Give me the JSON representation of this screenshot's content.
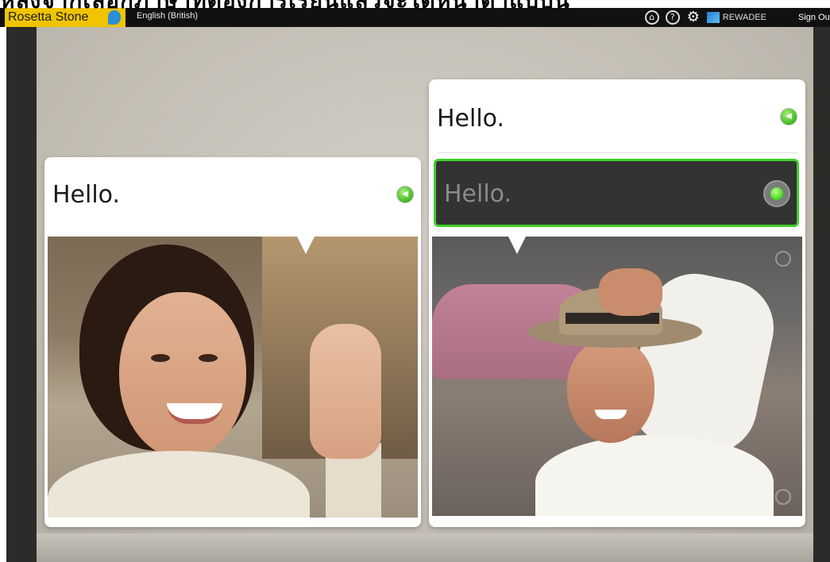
{
  "overlay": {
    "caption": "หลังจากเลือกภาษาที่ต้องการเรียนแล้วจะได้หน้าตาแบบนี้"
  },
  "topbar": {
    "logo_text": "Rosetta Stone",
    "language": "English (British)",
    "icons": [
      "home-icon",
      "help-icon",
      "settings-gear-icon"
    ],
    "user_name": "REWADEE",
    "sign_out": "Sign Out"
  },
  "left_card": {
    "prompt": "Hello.",
    "audio_icon": "speaker-icon",
    "image_icon": "woman-waving-photo"
  },
  "right_card": {
    "prompt": "Hello.",
    "audio_icon": "speaker-icon",
    "answer_text": "Hello.",
    "mic_icon": "microphone-icon",
    "image_icon": "man-with-hat-photo"
  },
  "colors": {
    "brand_yellow": "#f0c400",
    "active_green": "#3fd02a",
    "answer_box_bg": "#333333"
  }
}
